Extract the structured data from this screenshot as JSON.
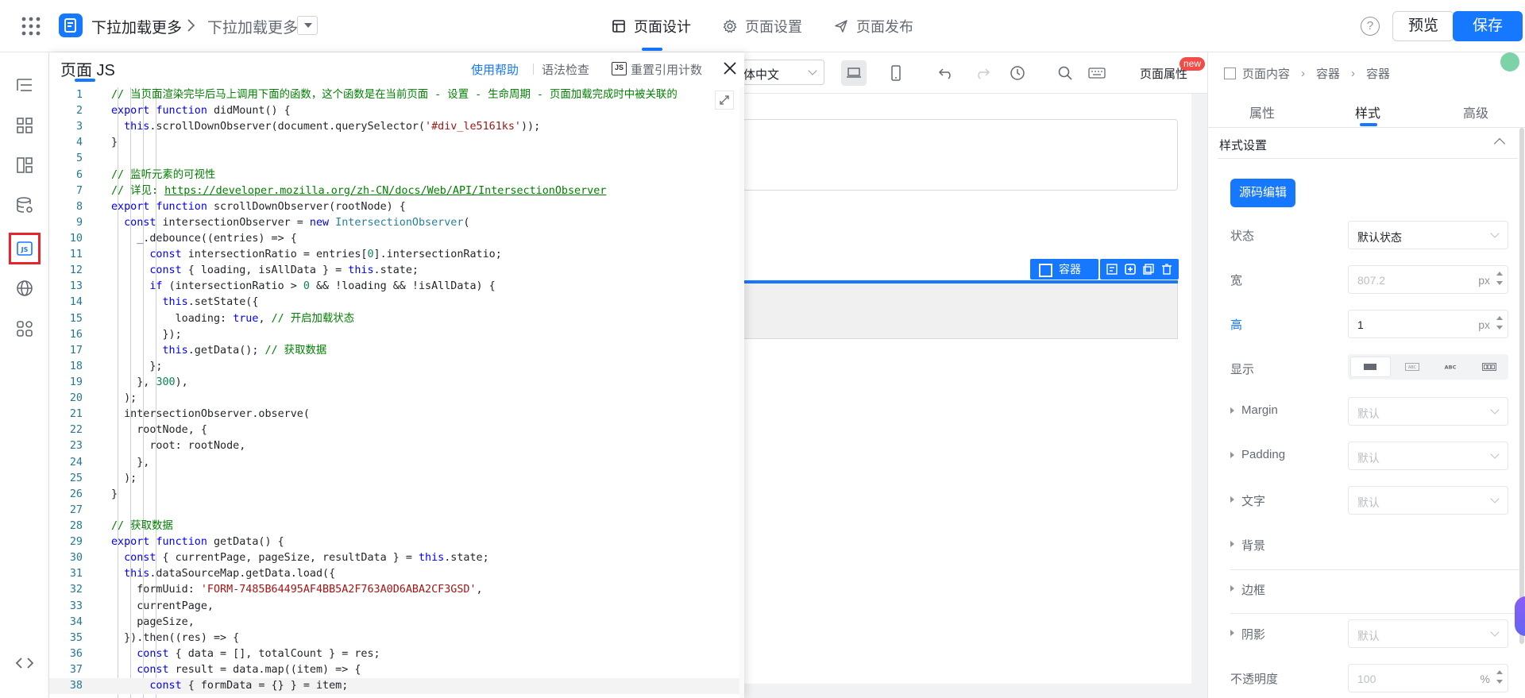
{
  "app": {
    "title": "下拉加载更多",
    "page_name": "下拉加载更多"
  },
  "topnav": {
    "design": "页面设计",
    "settings": "页面设置",
    "publish": "页面发布"
  },
  "header_actions": {
    "help": "?",
    "preview": "预览",
    "save": "保存"
  },
  "rail": [
    {
      "name": "outline-icon",
      "tooltip": ""
    },
    {
      "name": "components-icon"
    },
    {
      "name": "templates-icon"
    },
    {
      "name": "datasource-icon"
    },
    {
      "name": "js-icon",
      "label": "JS",
      "selected": true
    },
    {
      "name": "globe-icon"
    },
    {
      "name": "plugins-icon"
    },
    {
      "name": "code-icon"
    }
  ],
  "canvas_toolbar": {
    "lang": "体中文",
    "page_attr": "页面属性",
    "new_badge": "new"
  },
  "selection": {
    "tag": "容器"
  },
  "js_panel": {
    "title": "页面 JS",
    "help": "使用帮助",
    "lint": "语法检查",
    "reset_refs": "重置引用计数"
  },
  "code_lines": [
    "// 当页面渲染完毕后马上调用下面的函数，这个函数是在当前页面 - 设置 - 生命周期 - 页面加载完成时中被关联的",
    "export function didMount() {",
    "  this.scrollDownObserver(document.querySelector('#div_le5161ks'));",
    "}",
    "",
    "// 监听元素的可视性",
    "// 详见: https://developer.mozilla.org/zh-CN/docs/Web/API/IntersectionObserver",
    "export function scrollDownObserver(rootNode) {",
    "  const intersectionObserver = new IntersectionObserver(",
    "    _.debounce((entries) => {",
    "      const intersectionRatio = entries[0].intersectionRatio;",
    "      const { loading, isAllData } = this.state;",
    "      if (intersectionRatio > 0 && !loading && !isAllData) {",
    "        this.setState({",
    "          loading: true, // 开启加载状态",
    "        });",
    "        this.getData(); // 获取数据",
    "      };",
    "    }, 300),",
    "  );",
    "  intersectionObserver.observe(",
    "    rootNode, {",
    "      root: rootNode,",
    "    },",
    "  );",
    "}",
    "",
    "// 获取数据",
    "export function getData() {",
    "  const { currentPage, pageSize, resultData } = this.state;",
    "  this.dataSourceMap.getData.load({",
    "    formUuid: 'FORM-7485B64495AF4BB5A2F763A0D6ABA2CF3GSD',",
    "    currentPage,",
    "    pageSize,",
    "  }).then((res) => {",
    "    const { data = [], totalCount } = res;",
    "    const result = data.map((item) => {",
    "      const { formData = {} } = item;"
  ],
  "right_panel": {
    "crumbs": [
      "页面内容",
      "容器",
      "容器"
    ],
    "tabs": [
      "属性",
      "样式",
      "高级"
    ],
    "section": "样式设置",
    "source_edit": "源码编辑",
    "rows": {
      "state": {
        "label": "状态",
        "value": "默认状态"
      },
      "width": {
        "label": "宽",
        "value": "807.2",
        "unit": "px"
      },
      "height": {
        "label": "高",
        "value": "1",
        "unit": "px"
      },
      "display": {
        "label": "显示",
        "options": [
          "block",
          "ABC",
          "ABC",
          "inline-block"
        ]
      },
      "margin": {
        "label": "Margin",
        "value": "默认"
      },
      "padding": {
        "label": "Padding",
        "value": "默认"
      },
      "text": {
        "label": "文字",
        "value": "默认"
      },
      "background": {
        "label": "背景"
      },
      "border": {
        "label": "边框"
      },
      "shadow": {
        "label": "阴影",
        "value": "默认"
      },
      "opacity": {
        "label": "不透明度",
        "value": "100",
        "unit": "%"
      }
    }
  }
}
